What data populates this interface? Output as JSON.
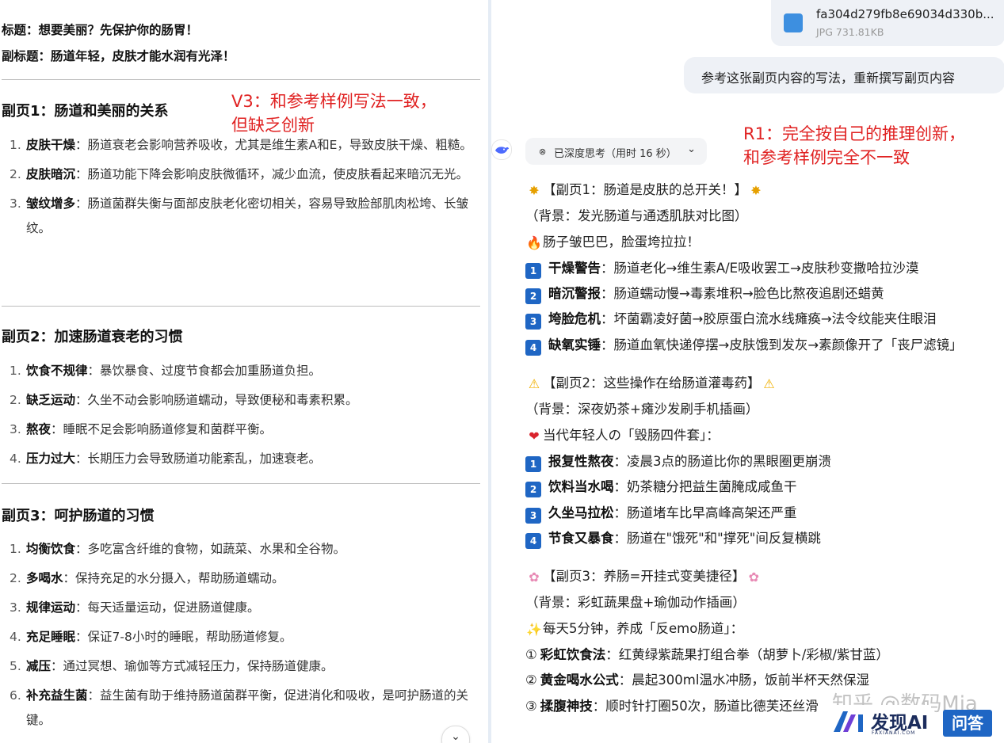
{
  "left": {
    "title_line": "标题：想要美丽？先保护你的肠胃！",
    "subtitle_line": "副标题：肠道年轻，皮肤才能水润有光泽！",
    "sections": [
      {
        "title": "副页1：肠道和美丽的关系",
        "items": [
          {
            "num": "1.",
            "bold": "皮肤干燥",
            "text": "：肠道衰老会影响营养吸收，尤其是维生素A和E，导致皮肤干燥、粗糙。"
          },
          {
            "num": "2.",
            "bold": "皮肤暗沉",
            "text": "：肠道功能下降会影响皮肤微循环，减少血流，使皮肤看起来暗沉无光。"
          },
          {
            "num": "3.",
            "bold": "皱纹增多",
            "text": "：肠道菌群失衡与面部皮肤老化密切相关，容易导致脸部肌肉松垮、长皱纹。"
          }
        ]
      },
      {
        "title": "副页2：加速肠道衰老的习惯",
        "items": [
          {
            "num": "1.",
            "bold": "饮食不规律",
            "text": "：暴饮暴食、过度节食都会加重肠道负担。"
          },
          {
            "num": "2.",
            "bold": "缺乏运动",
            "text": "：久坐不动会影响肠道蠕动，导致便秘和毒素积累。"
          },
          {
            "num": "3.",
            "bold": "熬夜",
            "text": "：睡眠不足会影响肠道修复和菌群平衡。"
          },
          {
            "num": "4.",
            "bold": "压力过大",
            "text": "：长期压力会导致肠道功能紊乱，加速衰老。"
          }
        ]
      },
      {
        "title": "副页3：呵护肠道的习惯",
        "items": [
          {
            "num": "1.",
            "bold": "均衡饮食",
            "text": "：多吃富含纤维的食物，如蔬菜、水果和全谷物。"
          },
          {
            "num": "2.",
            "bold": "多喝水",
            "text": "：保持充足的水分摄入，帮助肠道蠕动。"
          },
          {
            "num": "3.",
            "bold": "规律运动",
            "text": "：每天适量运动，促进肠道健康。"
          },
          {
            "num": "4.",
            "bold": "充足睡眠",
            "text": "：保证7-8小时的睡眠，帮助肠道修复。"
          },
          {
            "num": "5.",
            "bold": "减压",
            "text": "：通过冥想、瑜伽等方式减轻压力，保持肠道健康。"
          },
          {
            "num": "6.",
            "bold": "补充益生菌",
            "text": "：益生菌有助于维持肠道菌群平衡，促进消化和吸收，是呵护肠道的关键。"
          }
        ]
      }
    ],
    "note_v3_line1": "V3：和参考样例写法一致，",
    "note_v3_line2": "但缺乏创新"
  },
  "right": {
    "file": {
      "name": "fa304d279fb8e69034d330b...",
      "meta": "JPG 731.81KB"
    },
    "user_message": "参考这张副页内容的写法，重新撰写副页内容",
    "thinking_label": "已深度思考（用时 16 秒）",
    "note_r1_line1": "R1：完全按自己的推理创新，",
    "note_r1_line2": "和参考样例完全不一致",
    "lines": [
      {
        "icon": "✸",
        "icon2": "✸",
        "icon_name": "star-burst-icon",
        "cls": "ic-star",
        "text": "【副页1：肠道是皮肤的总开关！】"
      },
      {
        "text": "（背景：发光肠道与通透肌肤对比图）"
      },
      {
        "icon": "🔥",
        "icon_name": "fire-icon",
        "cls": "ic-fire",
        "text": "肠子皱巴巴，脸蛋垮拉拉！"
      },
      {
        "key": "1",
        "bold": "干燥警告",
        "text": "：肠道老化→维生素A/E吸收罢工→皮肤秒变撒哈拉沙漠"
      },
      {
        "key": "2",
        "bold": "暗沉警报",
        "text": "：肠道蠕动慢→毒素堆积→脸色比熬夜追剧还蜡黄"
      },
      {
        "key": "3",
        "bold": "垮脸危机",
        "text": "：坏菌霸凌好菌→胶原蛋白流水线瘫痪→法令纹能夹住眼泪"
      },
      {
        "key": "4",
        "bold": "缺氧实锤",
        "text": "：肠道血氧快递停摆→皮肤饿到发灰→素颜像开了「丧尸滤镜」",
        "wrap": true
      },
      {
        "icon": "⚠",
        "icon2": "⚠",
        "icon_name": "warning-icon",
        "cls": "ic-warn",
        "text": "【副页2：这些操作在给肠道灌毒药】",
        "gap": true
      },
      {
        "text": "（背景：深夜奶茶+瘫沙发刷手机插画）"
      },
      {
        "icon": "❤",
        "icon_name": "heart-icon",
        "cls": "ic-heart",
        "text": "当代年轻人の「毁肠四件套」："
      },
      {
        "key": "1",
        "bold": "报复性熬夜",
        "text": "：凌晨3点的肠道比你的黑眼圈更崩溃"
      },
      {
        "key": "2",
        "bold": "饮料当水喝",
        "text": "：奶茶糖分把益生菌腌成咸鱼干"
      },
      {
        "key": "3",
        "bold": "久坐马拉松",
        "text": "：肠道堵车比早高峰高架还严重"
      },
      {
        "key": "4",
        "bold": "节食又暴食",
        "text": "：肠道在\"饿死\"和\"撑死\"间反复横跳"
      },
      {
        "icon": "✿",
        "icon2": "✿",
        "icon_name": "flower-icon",
        "cls": "ic-flower",
        "text": "【副页3：养肠=开挂式变美捷径】",
        "gap": true
      },
      {
        "text": "（背景：彩虹蔬果盘+瑜伽动作插画）"
      },
      {
        "icon": "✨",
        "icon_name": "sparkles-icon",
        "cls": "ic-spark",
        "text": "每天5分钟，养成「反emo肠道」："
      },
      {
        "circ": "①",
        "bold": "彩虹饮食法",
        "text": "：红黄绿紫蔬果打组合拳（胡萝卜/彩椒/紫甘蓝）"
      },
      {
        "circ": "②",
        "bold": "黄金喝水公式",
        "text": "：晨起300ml温水冲肠，饭前半杯天然保湿"
      },
      {
        "circ": "③",
        "bold": "揉腹神技",
        "text": "：顺时针打圈50次，肠道比德芙还丝滑"
      }
    ],
    "watermark": "知乎 @数码Mia",
    "brand_name": "发现AI",
    "brand_sub": "FAXIANAI.COM",
    "wenda": "问答"
  }
}
